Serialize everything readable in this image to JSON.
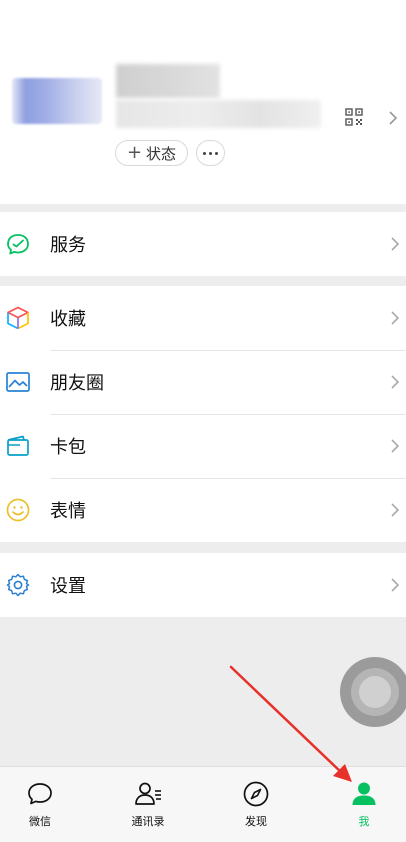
{
  "profile": {
    "status_label": "状态",
    "status_plus": "+"
  },
  "menu": {
    "services": {
      "label": "服务",
      "icon": "services-icon"
    },
    "favorites": {
      "label": "收藏",
      "icon": "favorites-cube-icon"
    },
    "moments": {
      "label": "朋友圈",
      "icon": "moments-image-icon"
    },
    "cards": {
      "label": "卡包",
      "icon": "card-wallet-icon"
    },
    "stickers": {
      "label": "表情",
      "icon": "smiley-icon"
    },
    "settings": {
      "label": "设置",
      "icon": "gear-icon"
    }
  },
  "tabs": [
    {
      "label": "微信",
      "icon": "chat-bubble-icon"
    },
    {
      "label": "通讯录",
      "icon": "contacts-icon"
    },
    {
      "label": "发现",
      "icon": "compass-icon"
    },
    {
      "label": "我",
      "icon": "person-icon",
      "active": true
    }
  ],
  "colors": {
    "accent_green": "#07c160",
    "arrow_red": "#e8302a",
    "background": "#ededed"
  }
}
